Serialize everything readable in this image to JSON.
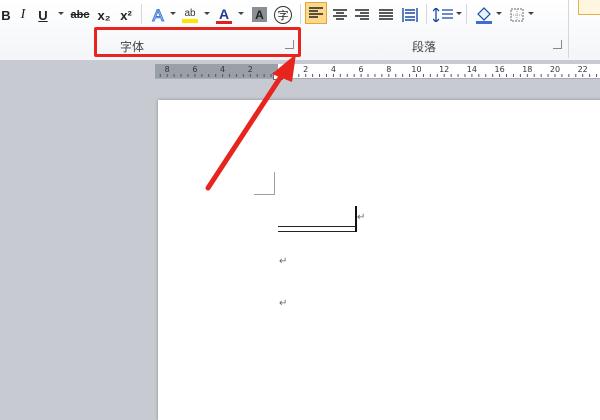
{
  "toolbar": {
    "bold": "B",
    "italic": "I",
    "underline": "U",
    "strikethrough": "abc",
    "subscript": "x₂",
    "superscript": "x²",
    "highlight": "ab",
    "font_color": "A",
    "char_shading": "A",
    "enclose": "字"
  },
  "groups": {
    "font": "字体",
    "paragraph": "段落"
  },
  "ruler": {
    "labels": [
      "8",
      "6",
      "4",
      "2",
      "2",
      "4",
      "6",
      "8",
      "10",
      "12",
      "14",
      "16",
      "18",
      "20",
      "22"
    ]
  },
  "document": {
    "paragraph_mark": "↵"
  },
  "colors": {
    "annotation": "#e8241f",
    "highlight_yellow": "#ffe600",
    "font_red": "#e02020",
    "active_button": "#fcd98a"
  }
}
